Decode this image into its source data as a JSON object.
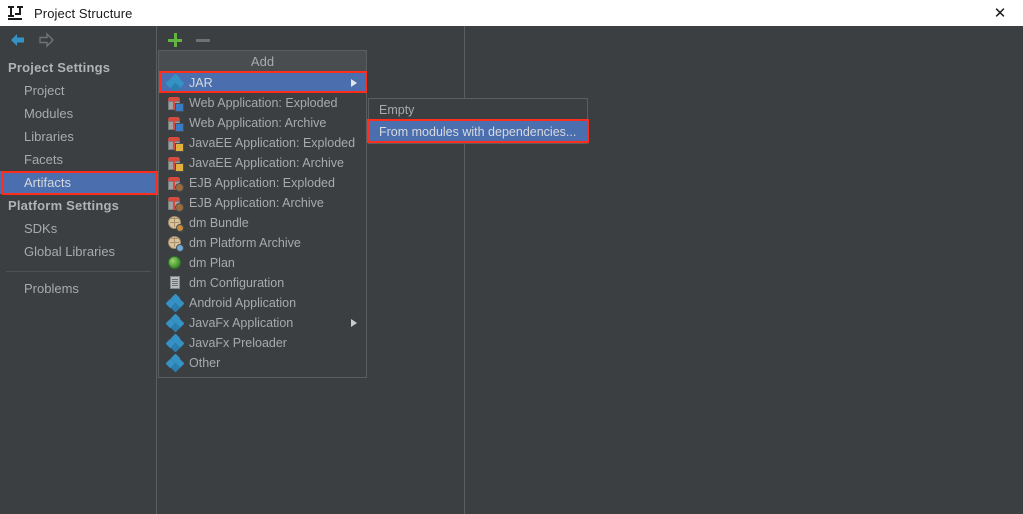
{
  "window": {
    "title": "Project Structure",
    "logo_icon": "intellij-idea-logo-icon",
    "close_icon": "close-icon"
  },
  "navigation": {
    "back_icon": "arrow-left-icon",
    "forward_icon": "arrow-right-icon"
  },
  "sidebar": {
    "groups": [
      {
        "label": "Project Settings",
        "items": [
          {
            "label": "Project",
            "selected": false
          },
          {
            "label": "Modules",
            "selected": false
          },
          {
            "label": "Libraries",
            "selected": false
          },
          {
            "label": "Facets",
            "selected": false
          },
          {
            "label": "Artifacts",
            "selected": true
          }
        ]
      },
      {
        "label": "Platform Settings",
        "items": [
          {
            "label": "SDKs",
            "selected": false
          },
          {
            "label": "Global Libraries",
            "selected": false
          }
        ]
      }
    ],
    "problems_label": "Problems"
  },
  "toolbar": {
    "add_icon": "plus-icon",
    "remove_icon": "minus-icon"
  },
  "popup_menu": {
    "header": "Add",
    "items": [
      {
        "label": "JAR",
        "icon": "diamond-cluster-icon",
        "selected": true,
        "submenu": true
      },
      {
        "label": "Web Application: Exploded",
        "icon": "gift-blue-icon",
        "selected": false,
        "submenu": false
      },
      {
        "label": "Web Application: Archive",
        "icon": "gift-blue-icon",
        "selected": false,
        "submenu": false
      },
      {
        "label": "JavaEE Application: Exploded",
        "icon": "gift-yellow-icon",
        "selected": false,
        "submenu": false
      },
      {
        "label": "JavaEE Application: Archive",
        "icon": "gift-yellow-icon",
        "selected": false,
        "submenu": false
      },
      {
        "label": "EJB Application: Exploded",
        "icon": "gift-brown-icon",
        "selected": false,
        "submenu": false
      },
      {
        "label": "EJB Application: Archive",
        "icon": "gift-brown-icon",
        "selected": false,
        "submenu": false
      },
      {
        "label": "dm Bundle",
        "icon": "sphere-icon",
        "selected": false,
        "submenu": false
      },
      {
        "label": "dm Platform Archive",
        "icon": "sphere-blue-icon",
        "selected": false,
        "submenu": false
      },
      {
        "label": "dm Plan",
        "icon": "globe-icon",
        "selected": false,
        "submenu": false
      },
      {
        "label": "dm Configuration",
        "icon": "document-icon",
        "selected": false,
        "submenu": false
      },
      {
        "label": "Android Application",
        "icon": "diamond-cluster-icon",
        "selected": false,
        "submenu": false
      },
      {
        "label": "JavaFx Application",
        "icon": "diamond-cluster-icon",
        "selected": false,
        "submenu": true
      },
      {
        "label": "JavaFx Preloader",
        "icon": "diamond-cluster-icon",
        "selected": false,
        "submenu": false
      },
      {
        "label": "Other",
        "icon": "diamond-cluster-icon",
        "selected": false,
        "submenu": false
      }
    ]
  },
  "submenu": {
    "items": [
      {
        "label": "Empty",
        "selected": false
      },
      {
        "label": "From modules with dependencies...",
        "selected": true
      }
    ]
  },
  "colors": {
    "selection_blue": "#4b6eaf",
    "annotation_red": "#ff2d1c",
    "panel_bg": "#3c3f41",
    "add_green": "#62b543"
  },
  "annotations": [
    {
      "name": "artifacts-highlight"
    },
    {
      "name": "jar-menu-item-highlight"
    },
    {
      "name": "from-modules-highlight"
    }
  ]
}
